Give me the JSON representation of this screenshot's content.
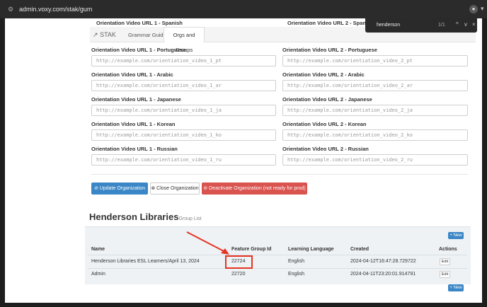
{
  "browser": {
    "url": "admin.voxy.com/stak/gum"
  },
  "find": {
    "query": "henderson",
    "count": "1/1",
    "prev": "^",
    "next": "v",
    "close": "×"
  },
  "nav": {
    "brand": "STAK",
    "tabs": [
      "Grammar Guide",
      "Orgs and Groups"
    ]
  },
  "fields": {
    "spanish": {
      "label1": "Orientation Video URL 1 - Spanish",
      "label2": "Orientation Video URL 2 - Spanish"
    },
    "rows": [
      {
        "label1": "Orientation Video URL 1 - Portuguese",
        "value1": "http://example.com/orientiation_video_1_pt",
        "label2": "Orientation Video URL 2 - Portuguese",
        "value2": "http://example.com/orientiation_video_2_pt"
      },
      {
        "label1": "Orientation Video URL 1 - Arabic",
        "value1": "http://example.com/orientiation_video_1_ar",
        "label2": "Orientation Video URL 2 - Arabic",
        "value2": "http://example.com/orientiation_video_2_ar"
      },
      {
        "label1": "Orientation Video URL 1 - Japanese",
        "value1": "http://example.com/orientiation_video_1_ja",
        "label2": "Orientation Video URL 2 - Japanese",
        "value2": "http://example.com/orientiation_video_2_ja"
      },
      {
        "label1": "Orientation Video URL 1 - Korean",
        "value1": "http://example.com/orientiation_video_1_ko",
        "label2": "Orientation Video URL 2 - Korean",
        "value2": "http://example.com/orientiation_video_2_ko"
      },
      {
        "label1": "Orientation Video URL 1 - Russian",
        "value1": "http://example.com/orientiation_video_1_ru",
        "label2": "Orientation Video URL 2 - Russian",
        "value2": "http://example.com/orientiation_video_2_ru"
      }
    ]
  },
  "actions": {
    "update": "Update Organization",
    "close": "Close Organization",
    "deactivate": "Deactivate Organization (not ready for prod)"
  },
  "groups": {
    "title": "Henderson Libraries",
    "subtitle": "Group List",
    "new_label": "+ New",
    "columns": [
      "Name",
      "Feature Group Id",
      "Learning Language",
      "Created",
      "Actions"
    ],
    "rows": [
      {
        "name": "Henderson Libraries ESL Learners/April 13, 2024",
        "feature_group_id": "22724",
        "language": "English",
        "created": "2024-04-12T16:47:28.729722",
        "action": "Edit"
      },
      {
        "name": "Admin",
        "feature_group_id": "22720",
        "language": "English",
        "created": "2024-04-11T23:20:01.914791",
        "action": "Edit"
      }
    ]
  },
  "colors": {
    "primary": "#3b86c6",
    "danger": "#d9534f",
    "annotation": "#e53422"
  }
}
